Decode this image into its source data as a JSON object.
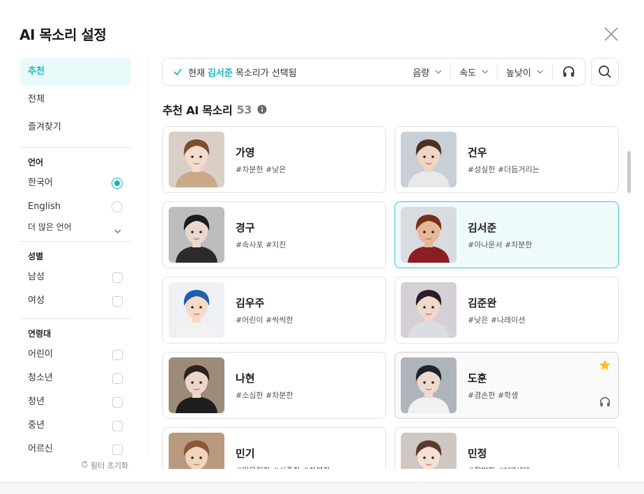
{
  "dialog": {
    "title": "AI 목소리 설정",
    "close_icon": "close-icon"
  },
  "sidebar": {
    "nav": [
      {
        "label": "추천",
        "active": true
      },
      {
        "label": "전체",
        "active": false
      },
      {
        "label": "즐겨찾기",
        "active": false
      }
    ],
    "language": {
      "title": "언어",
      "options": [
        {
          "label": "한국어",
          "selected": true
        },
        {
          "label": "English",
          "selected": false
        }
      ],
      "more_label": "더 많은 언어"
    },
    "gender": {
      "title": "성별",
      "options": [
        {
          "label": "남성",
          "checked": false
        },
        {
          "label": "여성",
          "checked": false
        }
      ]
    },
    "age": {
      "title": "연령대",
      "options": [
        {
          "label": "어린이",
          "checked": false
        },
        {
          "label": "청소년",
          "checked": false
        },
        {
          "label": "청년",
          "checked": false
        },
        {
          "label": "중년",
          "checked": false
        },
        {
          "label": "어르신",
          "checked": false
        }
      ]
    },
    "reset_label": "필터 초기화"
  },
  "toolbar": {
    "status_prefix": "현재",
    "selected_voice": "김서준",
    "status_suffix": "목소리가 선택됨",
    "volume_label": "음량",
    "speed_label": "속도",
    "pitch_label": "높낮이"
  },
  "list": {
    "title": "추천 AI 목소리",
    "count": "53",
    "voices": [
      {
        "name": "가영",
        "tags": "#차분한 #낮은",
        "avatar": {
          "bg": "#d9cfc7",
          "hair": "#7a4e2f",
          "skin": "#f3dccb",
          "cloth": "#c9a98a"
        }
      },
      {
        "name": "건우",
        "tags": "#성실한 #더듬거리는",
        "avatar": {
          "bg": "#c9cfd6",
          "hair": "#4a3126",
          "skin": "#efd5c2",
          "cloth": "#e9e9ec"
        }
      },
      {
        "name": "경구",
        "tags": "#속사포 #지친",
        "avatar": {
          "bg": "#bdbdbd",
          "hair": "#1c1c1e",
          "skin": "#ead8cc",
          "cloth": "#2b2b2e"
        }
      },
      {
        "name": "김서준",
        "tags": "#아나운서 #차분한",
        "selected": true,
        "avatar": {
          "bg": "#d8dbdf",
          "hair": "#7a2e1c",
          "skin": "#e6b898",
          "cloth": "#8a1e22"
        }
      },
      {
        "name": "김우주",
        "tags": "#어린이 #씩씩한",
        "avatar": {
          "bg": "#eef0f4",
          "hair": "#1f5fae",
          "skin": "#f5d9c6",
          "cloth": "#f2f2f2"
        }
      },
      {
        "name": "김준완",
        "tags": "#낮은 #나레이션",
        "avatar": {
          "bg": "#d5d0d6",
          "hair": "#2a1e2c",
          "skin": "#f0d8cc",
          "cloth": "#dcdde4"
        }
      },
      {
        "name": "나현",
        "tags": "#소심한 #차분한",
        "avatar": {
          "bg": "#9c8b78",
          "hair": "#2a2220",
          "skin": "#ecd6c8",
          "cloth": "#1e1e1e"
        }
      },
      {
        "name": "도훈",
        "tags": "#겸손한 #학생",
        "starred": true,
        "hover": true,
        "avatar": {
          "bg": "#aeb4ba",
          "hair": "#1e232c",
          "skin": "#eed9cf",
          "cloth": "#f0f0f2"
        }
      },
      {
        "name": "민기",
        "tags": "#믿음직한 #신중한 #차분한",
        "avatar": {
          "bg": "#b89a7e",
          "hair": "#8a5a35",
          "skin": "#f0d4bd",
          "cloth": "#5d4a3a"
        }
      },
      {
        "name": "민정",
        "tags": "#활발한 #MZ세대",
        "avatar": {
          "bg": "#cfc7c2",
          "hair": "#5a3a2c",
          "skin": "#f6e0d4",
          "cloth": "#e8dcd6"
        }
      }
    ]
  },
  "colors": {
    "accent": "#16b6c1",
    "star": "#f6c225"
  }
}
